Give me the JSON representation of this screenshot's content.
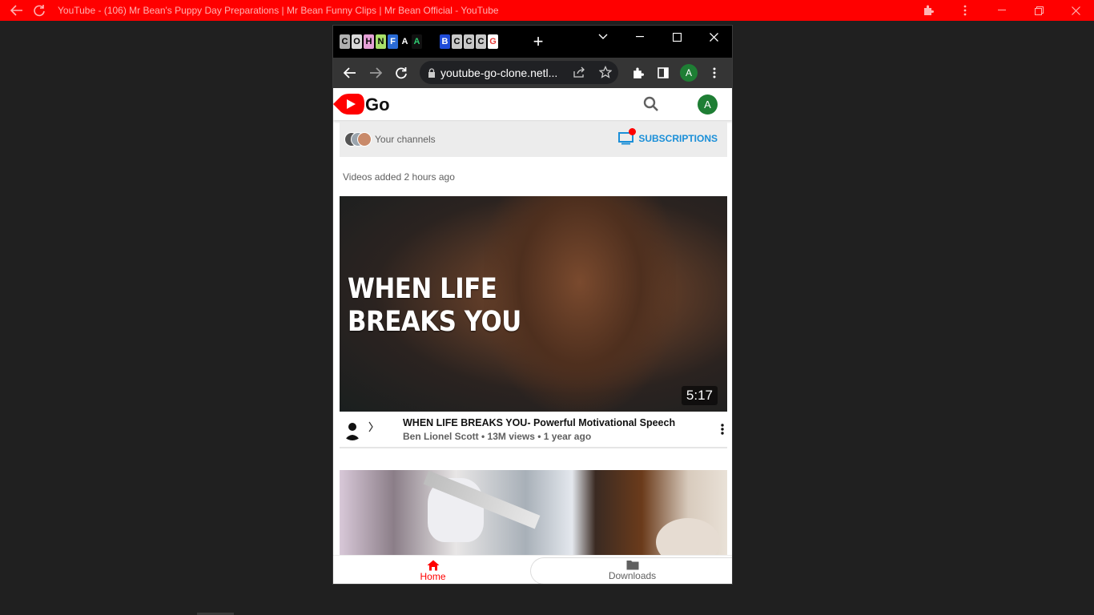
{
  "outer_window": {
    "title": "YouTube - (106) Mr Bean's Puppy Day Preparations | Mr Bean Funny Clips | Mr Bean Official - YouTube",
    "icons": [
      "back-arrow-icon",
      "reload-icon",
      "puzzle-icon",
      "more-vert-icon",
      "minimize-icon",
      "restore-icon",
      "close-icon"
    ]
  },
  "browser": {
    "tab_icons": [
      "C",
      "O",
      "H",
      "N",
      "F",
      "A",
      "A",
      "B",
      "C",
      "C",
      "C",
      "G"
    ],
    "new_tab_label": "+",
    "url": "youtube-go-clone.netl...",
    "profile_initial": "A"
  },
  "header": {
    "logo_text": "Go",
    "avatar_initial": "A"
  },
  "channels": {
    "label": "Your channels",
    "subscriptions_label": "SUBSCRIPTIONS"
  },
  "feed": {
    "section_label": "Videos added 2 hours ago",
    "videos": [
      {
        "thumb_text_line1": "WHEN LIFE",
        "thumb_text_line2": "BREAKS YOU",
        "duration": "5:17",
        "title": "WHEN LIFE BREAKS YOU- Powerful Motivational Speech",
        "subtitle": "Ben Lionel Scott • 13M views • 1 year ago"
      }
    ]
  },
  "bottom_nav": {
    "home_label": "Home",
    "downloads_label": "Downloads"
  },
  "colors": {
    "brand_red": "#ff0000",
    "link_blue": "#1a8fd8",
    "avatar_green": "#1e7e34"
  }
}
